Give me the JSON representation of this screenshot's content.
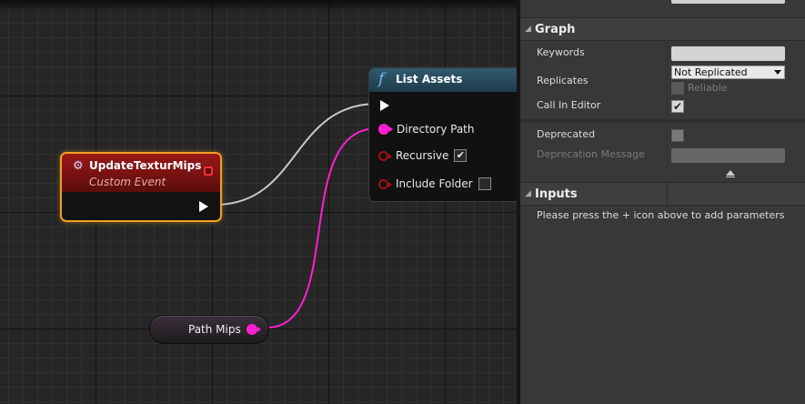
{
  "graph": {
    "event_node": {
      "title": "UpdateTexturMips",
      "subtitle": "Custom Event",
      "icon": "custom-event-icon"
    },
    "function_node": {
      "icon": "f",
      "title": "List Assets",
      "pins": [
        {
          "label": "Directory Path",
          "type": "string-filled"
        },
        {
          "label": "Recursive",
          "type": "bool",
          "checked": true
        },
        {
          "label": "Include Folder",
          "type": "bool",
          "checked": false
        }
      ]
    },
    "variable_node": {
      "label": "Path Mips"
    },
    "colors": {
      "string_pin": "#ff1fd0",
      "bool_pin": "#a01010",
      "event_border": "#f0a020",
      "event_header": "#9a1818",
      "function_header": "#2f5a6e"
    }
  },
  "details": {
    "graph_section": {
      "title": "Graph",
      "keywords_label": "Keywords",
      "keywords_value": "",
      "replicates_label": "Replicates",
      "replicates_value": "Not Replicated",
      "reliable_label": "Reliable",
      "call_in_editor_label": "Call In Editor",
      "call_in_editor_checked": true,
      "deprecated_label": "Deprecated",
      "deprecated_checked": false,
      "deprecation_message_label": "Deprecation Message",
      "deprecation_message_value": ""
    },
    "inputs_section": {
      "title": "Inputs",
      "hint": "Please press the + icon above to add parameters"
    }
  }
}
